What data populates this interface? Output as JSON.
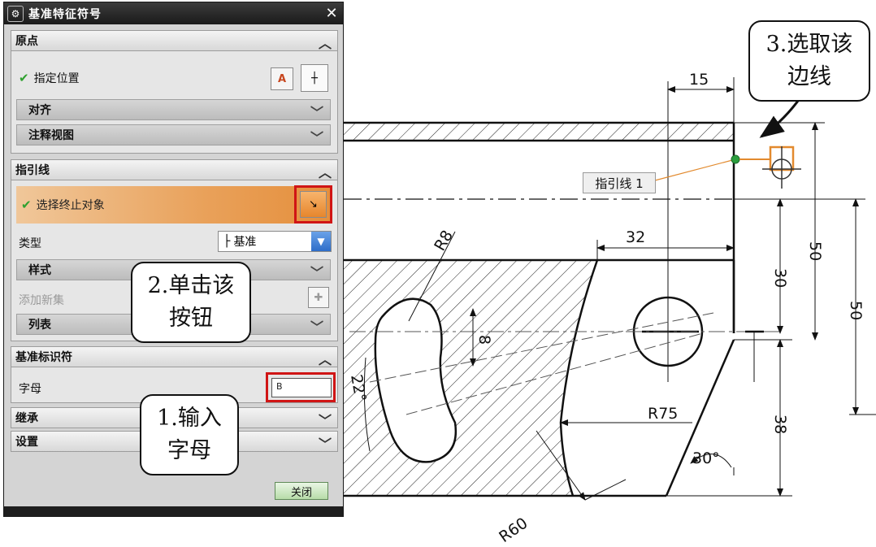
{
  "dialog": {
    "title": "基准特征符号",
    "title_icon": "gear-icon",
    "close_icon": "close-icon",
    "sections": {
      "origin": {
        "label": "原点",
        "specify_location": "指定位置",
        "align": "对齐",
        "annotation_view": "注释视图"
      },
      "leader": {
        "label": "指引线",
        "select_terminating": "选择终止对象",
        "type_label": "类型",
        "type_value": "基准",
        "style": "样式",
        "add_new_set": "添加新集",
        "list": "列表"
      },
      "datum_identifier": {
        "label": "基准标识符",
        "letter_label": "字母",
        "letter_value": "B"
      },
      "inherit": {
        "label": "继承"
      },
      "settings": {
        "label": "设置"
      }
    },
    "close_button": "关闭"
  },
  "callouts": {
    "step1": [
      "1.输入",
      "字母"
    ],
    "step2": [
      "2.单击该",
      "按钮"
    ],
    "step3": [
      "3.选取该",
      "边线"
    ]
  },
  "drawing": {
    "leader_label": "指引线 1",
    "dimensions": {
      "d15": "15",
      "d32": "32",
      "d30": "30",
      "d50a": "50",
      "d50b": "50",
      "d38": "38",
      "r75": "R75",
      "r60": "R60",
      "r8": "R8",
      "a30": "30°",
      "a22": "22°",
      "d8": "8"
    }
  },
  "colors": {
    "highlight_red": "#d01515",
    "selection_orange": "#e9a15a",
    "check_green": "#2fa12f"
  }
}
